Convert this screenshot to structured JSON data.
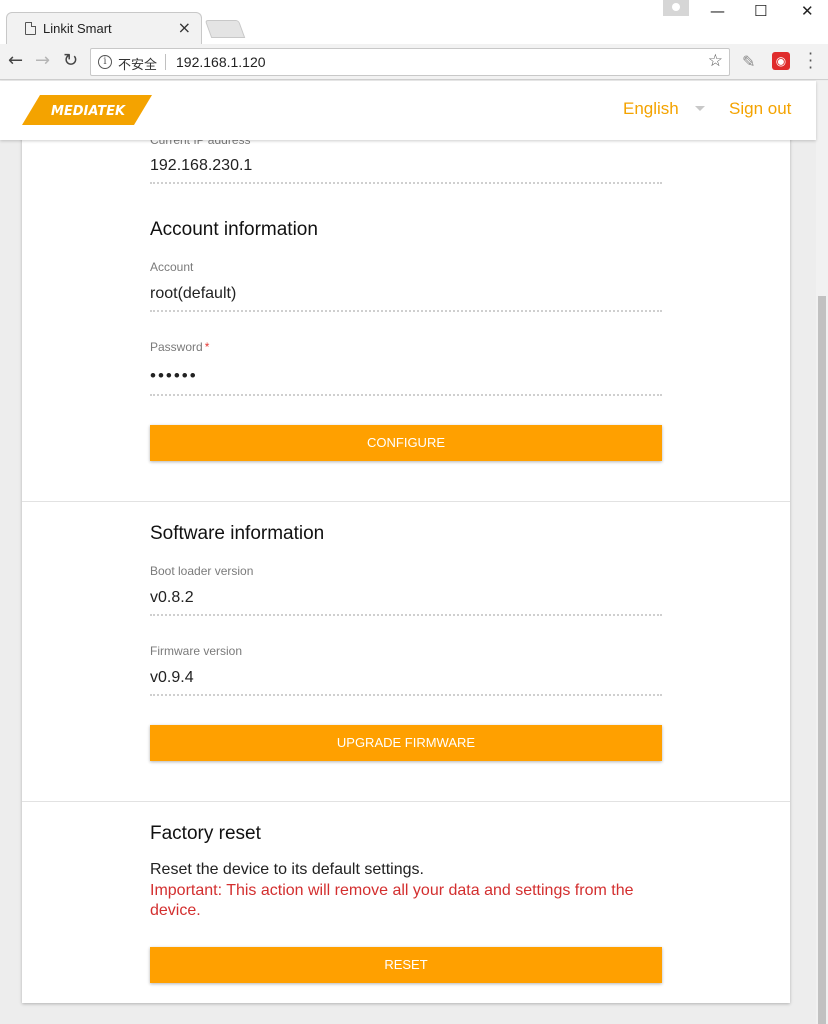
{
  "browser": {
    "tab_title": "Linkit Smart",
    "tab_close": "×",
    "minimize": "—",
    "maximize": "☐",
    "close": "✕",
    "back": "←",
    "forward": "→",
    "reload": "↻",
    "security_label": "不安全",
    "url": "192.168.1.120",
    "bookmark_icon": "☆"
  },
  "header": {
    "logo_text": "MEDIATEK",
    "language": "English",
    "sign_out": "Sign out",
    "brand_color": "#f4a300"
  },
  "network": {
    "current_ip_label": "Current IP address",
    "current_ip_value": "192.168.230.1"
  },
  "account": {
    "heading": "Account information",
    "account_label": "Account",
    "account_value": "root(default)",
    "password_label": "Password",
    "password_required": "*",
    "password_value": "••••••",
    "configure_button": "CONFIGURE"
  },
  "software": {
    "heading": "Software information",
    "bootloader_label": "Boot loader version",
    "bootloader_value": "v0.8.2",
    "firmware_label": "Firmware version",
    "firmware_value": "v0.9.4",
    "upgrade_button": "UPGRADE FIRMWARE"
  },
  "factory_reset": {
    "heading": "Factory reset",
    "description": "Reset the device to its default settings.",
    "warning": "Important: This action will remove all your data and settings from the device.",
    "reset_button": "RESET"
  },
  "colors": {
    "button": "#ffa000",
    "warning": "#d32f2f"
  }
}
